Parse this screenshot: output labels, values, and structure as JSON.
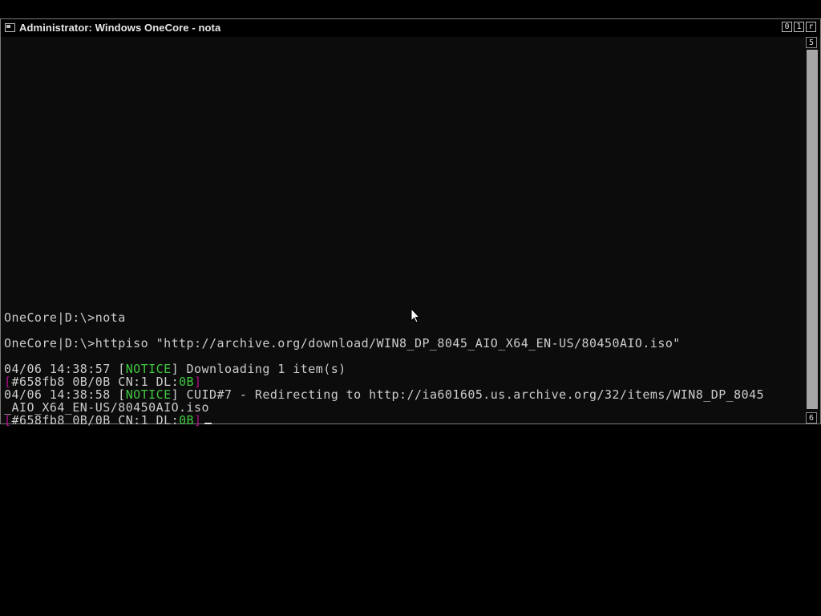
{
  "window": {
    "title": "Administrator:  Windows OneCore - nota",
    "buttons": [
      "0",
      "1",
      "r"
    ]
  },
  "scrollbar": {
    "top_label": "5",
    "bottom_label": "6"
  },
  "terminal": {
    "line1": "OneCore|D:\\>nota",
    "line2": "OneCore|D:\\>httpiso \"http://archive.org/download/WIN8_DP_8045_AIO_X64_EN-US/80450AIO.iso\"",
    "line3": {
      "timestamp": "04/06 14:38:57 [",
      "level": "NOTICE",
      "message": "] Downloading 1 item(s)"
    },
    "line4": {
      "open": "[",
      "text": "#658fb8 0B/0B CN:1 DL:",
      "rate": "0B",
      "close": "]"
    },
    "line5": {
      "timestamp": "04/06 14:38:58 [",
      "level": "NOTICE",
      "message": "] CUID#7 - Redirecting to http://ia601605.us.archive.org/32/items/WIN8_DP_8045"
    },
    "line6": "_AIO_X64_EN-US/80450AIO.iso",
    "line7": {
      "open": "[",
      "text": "#658fb8 0B/0B CN:1 DL:",
      "rate": "0B",
      "close": "]"
    }
  },
  "colors": {
    "notice": "#3fc83f",
    "bracket": "#b0108a",
    "text": "#cccccc"
  }
}
